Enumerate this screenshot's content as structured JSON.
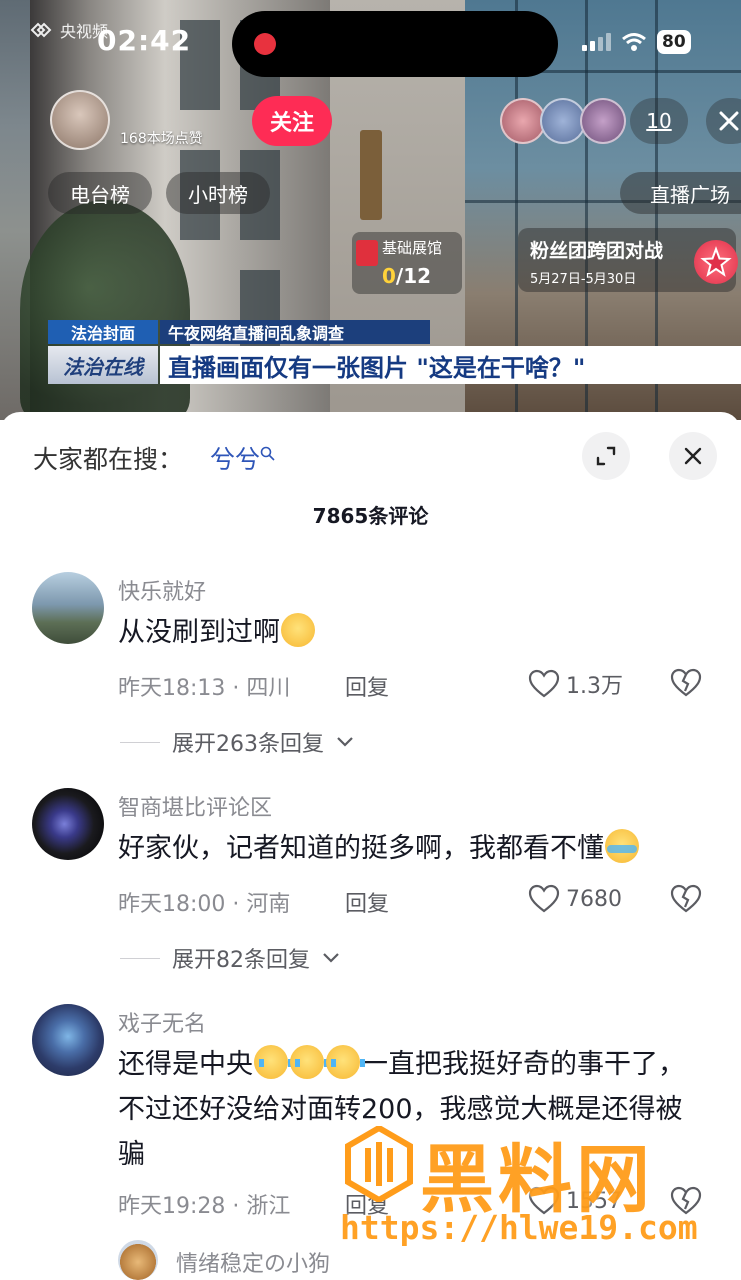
{
  "status_bar": {
    "time": "02:42",
    "channel_logo_text": "央视频",
    "battery": "80"
  },
  "live": {
    "likes_text": "168本场点赞",
    "follow_label": "关注",
    "tab_radio_rank": "电台榜",
    "tab_hour_rank": "小时榜",
    "viewer_count": "10",
    "live_plaza": "直播广场",
    "exhibit": {
      "title": "基础展馆",
      "current": "0",
      "total": "/12"
    },
    "fan_battle": {
      "title": "粉丝团跨团对战",
      "dates": "5月27日-5月30日"
    }
  },
  "news": {
    "tag_top": "法治封面",
    "tag_bottom": "法治在线",
    "subtitle": "午夜网络直播间乱象调查",
    "headline": "直播画面仅有一张图片 \"这是在干啥？\""
  },
  "sheet": {
    "search_label": "大家都在搜：",
    "search_term": "兮兮",
    "comment_count": "7865条评论"
  },
  "comments": [
    {
      "user": "快乐就好",
      "text": "从没刷到过啊",
      "time": "昨天18:13",
      "location": "四川",
      "reply": "回复",
      "likes": "1.3万",
      "expand": "展开263条回复"
    },
    {
      "user": "智商堪比评论区",
      "text": "好家伙，记者知道的挺多啊，我都看不懂",
      "time": "昨天18:00",
      "location": "河南",
      "reply": "回复",
      "likes": "7680",
      "expand": "展开82条回复"
    },
    {
      "user": "戏子无名",
      "text_part1": "还得是中央",
      "text_part2": "一直把我挺好奇的事干了，不过还好没给对面转200，我感觉大概是还得被骗",
      "time": "昨天19:28",
      "location": "浙江",
      "reply": "回复",
      "likes": "1557"
    },
    {
      "user": "情绪稳定の小狗"
    }
  ],
  "watermark": {
    "name": "黑料网",
    "url": "https://hlwe19.com"
  },
  "colors": {
    "follow": "#fe2c55",
    "search_term": "#2e55b8",
    "news_blue": "#1c3f7c",
    "watermark": "#ff9c1a"
  }
}
